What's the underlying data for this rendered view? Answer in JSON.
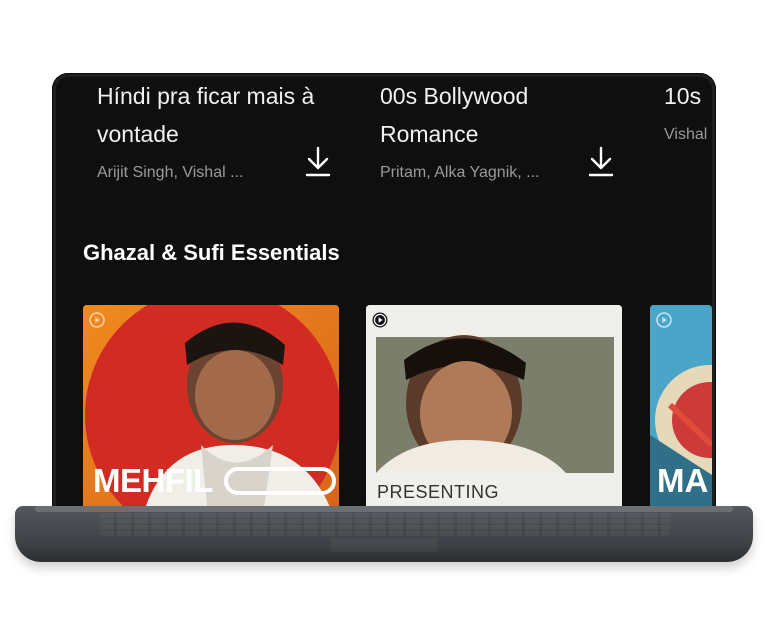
{
  "playlists_top": [
    {
      "title_line1": "Híndi pra ficar mais à",
      "title_line2": "vontade",
      "artists": "Arijit Singh, Vishal ..."
    },
    {
      "title_line1": "00s Bollywood",
      "title_line2": "Romance",
      "artists": "Pritam, Alka Yagnik, ..."
    },
    {
      "title_line1": "10s",
      "title_line2": "",
      "artists": "Vishal"
    }
  ],
  "section": {
    "title": "Ghazal & Sufi Essentials"
  },
  "covers": [
    {
      "overlay_text": "MEHFIL",
      "bg": "#e07a1c"
    },
    {
      "overlay_text": "PRESENTING",
      "bg": "#f1f1ef"
    },
    {
      "overlay_text": "MA",
      "bg": "#4aa5c9"
    }
  ],
  "colors": {
    "screen_bg": "#0f0f10",
    "text_primary": "#f1f1f1",
    "text_secondary": "#9a9a9a"
  },
  "icons": [
    "download-icon",
    "play-badge-icon"
  ]
}
